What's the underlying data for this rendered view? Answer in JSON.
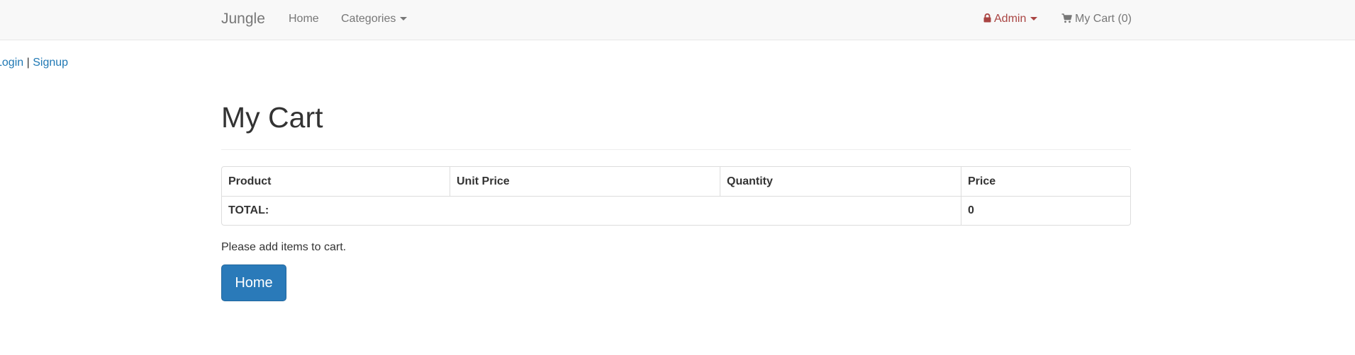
{
  "navbar": {
    "brand": "Jungle",
    "home": "Home",
    "categories": "Categories",
    "admin": "Admin",
    "cart": "My Cart (0)",
    "icons": {
      "lock": "lock-icon",
      "cart": "cart-icon"
    },
    "colors": {
      "admin": "#a94442",
      "link": "#777777"
    }
  },
  "auth": {
    "login": "Login",
    "separator": "|",
    "signup": "Signup"
  },
  "main": {
    "title": "My Cart",
    "table": {
      "headers": [
        "Product",
        "Unit Price",
        "Quantity",
        "Price"
      ],
      "total_label": "TOTAL:",
      "total_value": "0"
    },
    "empty_message": "Please add items to cart.",
    "home_button": "Home"
  },
  "colors": {
    "primary": "#2a7ab9",
    "link": "#1f78b4"
  }
}
